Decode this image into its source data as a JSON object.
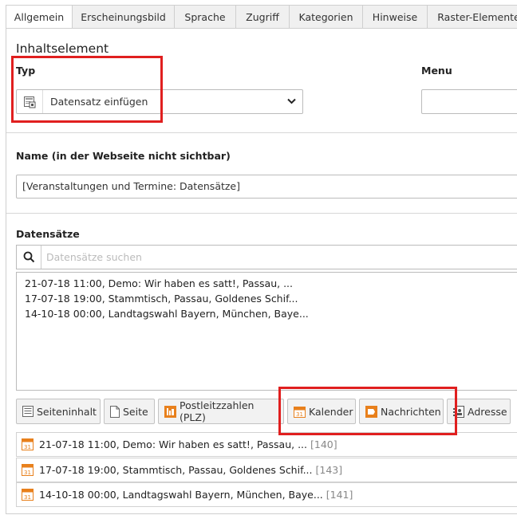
{
  "tabs": [
    "Allgemein",
    "Erscheinungsbild",
    "Sprache",
    "Zugriff",
    "Kategorien",
    "Hinweise",
    "Raster-Elemente"
  ],
  "section_title": "Inhaltselement",
  "typ": {
    "label": "Typ",
    "value": "Datensatz einfügen"
  },
  "menu": {
    "label": "Menu",
    "value": ""
  },
  "name": {
    "label": "Name (in der Webseite nicht sichtbar)",
    "value": "[Veranstaltungen und Termine: Datensätze]"
  },
  "datensaetze": {
    "label": "Datensätze",
    "search_placeholder": "Datensätze suchen",
    "selected": [
      "21-07-18 11:00, Demo: Wir haben es satt!, Passau, ...",
      "17-07-18 19:00, Stammtisch, Passau, Goldenes Schif...",
      "14-10-18 00:00, Landtagswahl Bayern, München, Baye..."
    ]
  },
  "buttons": {
    "seiteninhalt": "Seiteninhalt",
    "seite": "Seite",
    "plz": "Postleitzzahlen (PLZ)",
    "kalender": "Kalender",
    "nachrichten": "Nachrichten",
    "adresse": "Adresse"
  },
  "records": [
    {
      "title": "21-07-18 11:00, Demo: Wir haben es satt!, Passau, ...",
      "id": "[140]"
    },
    {
      "title": "17-07-18 19:00, Stammtisch, Passau, Goldenes Schif...",
      "id": "[143]"
    },
    {
      "title": "14-10-18 00:00, Landtagswahl Bayern, München, Baye...",
      "id": "[141]"
    }
  ],
  "icons": {
    "calendar": "calendar-icon",
    "search": "search-icon",
    "page": "page-icon",
    "content": "content-icon",
    "news": "news-icon",
    "address": "address-icon",
    "plz": "plz-icon",
    "record_type": "insert-records-icon"
  },
  "colors": {
    "highlight": "#e01f1f",
    "calendar_orange": "#e8801c"
  }
}
